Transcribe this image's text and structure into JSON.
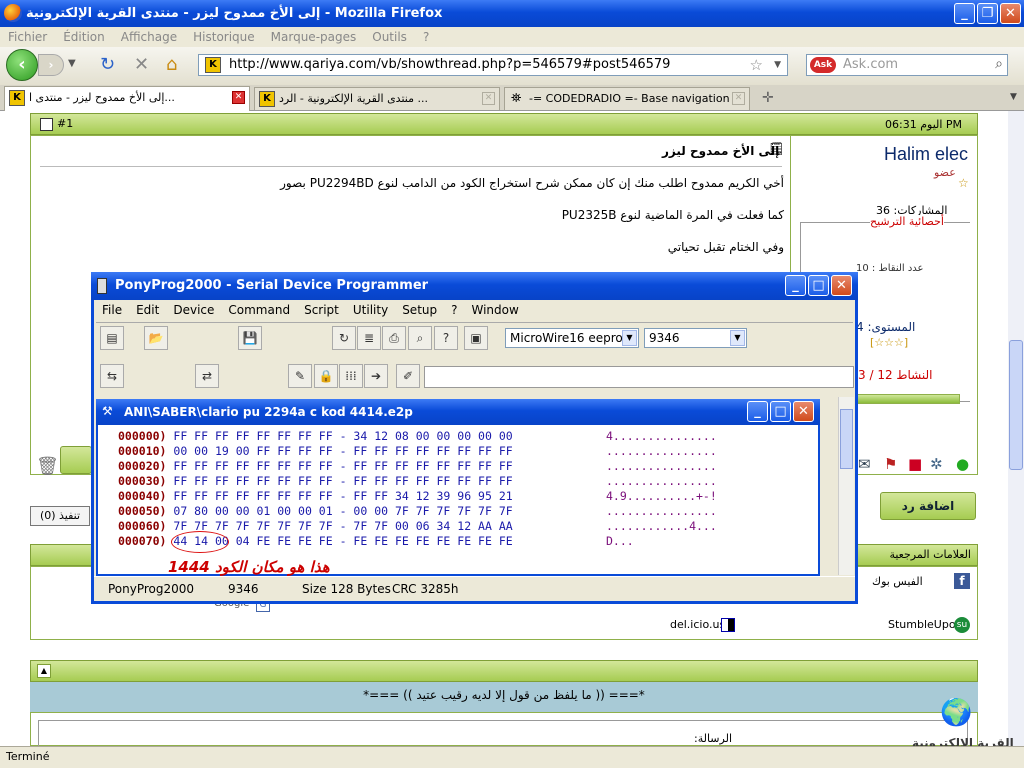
{
  "browser": {
    "title": "إلى الأخ ممدوح ليزر - منتدى القرية الإلكترونية - Mozilla Firefox",
    "menu": [
      "Fichier",
      "Édition",
      "Affichage",
      "Historique",
      "Marque-pages",
      "Outils",
      "?"
    ],
    "url": "http://www.qariya.com/vb/showthread.php?p=546579#post546579",
    "search_placeholder": "Ask.com",
    "search_engine_label": "Ask",
    "tabs": [
      {
        "label": "إلى الأخ ممدوح ليزر - منتدى ا...",
        "active": true
      },
      {
        "label": "منتدى القرية الإلكترونية - الرد ...",
        "active": false
      },
      {
        "label": "-= CODEDRADIO =- Base navigation",
        "active": false
      }
    ],
    "status": "Terminé"
  },
  "forum": {
    "post_number": "#1",
    "post_time": "اليوم 06:31 PM",
    "username": "Halim elec",
    "user_role": "عضو",
    "posts_label": "المشاركات: 36",
    "stats_title": "أحصائية الترشيح",
    "points_label": "عدد النقاط : 10",
    "level_label": "المستوى: 4",
    "level_stars": "[☆☆☆]",
    "activity_label": "النشاط 12 / 3",
    "post_title": "إلى الأخ ممدوح ليزر",
    "post_lines": [
      "أخي الكريم ممدوح اطلب منك إن كان ممكن شرح استخراج الكود من الدامب لنوع PU2294BD بصور",
      "كما فعلت في المرة الماضية لنوع PU2325B",
      "وفي الختام تقبل تحياتي"
    ],
    "reply_button": "اضافة رد",
    "execute_button": "(0) تنفيذ",
    "bookmarks_title": "العلامات المرجعية",
    "bookmarks": [
      "الفيس بوك",
      "StumbleUpon",
      "del.icio.us",
      "Google"
    ],
    "quote": "*=== (( ما يلفظ من قول إلا لديه رقيب عتيد )) ===*",
    "message_label": "الرسالة:",
    "logo_text": "القرية الالكترونية"
  },
  "pony": {
    "title": "PonyProg2000 - Serial Device Programmer",
    "menu": [
      "File",
      "Edit",
      "Device",
      "Command",
      "Script",
      "Utility",
      "Setup",
      "?",
      "Window"
    ],
    "device_family": "MicroWire16 eeprom",
    "device_model": "9346",
    "child_title": "ANI\\SABER\\clario pu 2294a c kod 4414.e2p",
    "hex_rows": [
      {
        "addr": "000000)",
        "bytes": "FF FF FF FF FF FF FF FF - 34 12 08 00 00 00 00 00",
        "ascii": "4..............."
      },
      {
        "addr": "000010)",
        "bytes": "00 00 19 00 FF FF FF FF - FF FF FF FF FF FF FF FF",
        "ascii": "................"
      },
      {
        "addr": "000020)",
        "bytes": "FF FF FF FF FF FF FF FF - FF FF FF FF FF FF FF FF",
        "ascii": "................"
      },
      {
        "addr": "000030)",
        "bytes": "FF FF FF FF FF FF FF FF - FF FF FF FF FF FF FF FF",
        "ascii": "................"
      },
      {
        "addr": "000040)",
        "bytes": "FF FF FF FF FF FF FF FF - FF FF 34 12 39 96 95 21",
        "ascii": "4.9..........+-!"
      },
      {
        "addr": "000050)",
        "bytes": "07 80 00 00 01 00 00 01 - 00 00 7F 7F 7F 7F 7F 7F",
        "ascii": "................"
      },
      {
        "addr": "000060)",
        "bytes": "7F 7F 7F 7F 7F 7F 7F 7F - 7F 7F 00 06 34 12 AA AA",
        "ascii": "............4..."
      },
      {
        "addr": "000070)",
        "bytes": "44 14 00 04 FE FE FE FE - FE FE FE FE FE FE FE FE",
        "ascii": "D..."
      }
    ],
    "annotation": "هذا هو مكان الكود 1444",
    "status": {
      "app": "PonyProg2000",
      "model": "9346",
      "size": "Size  128 Bytes",
      "crc": "CRC  3285h"
    }
  }
}
